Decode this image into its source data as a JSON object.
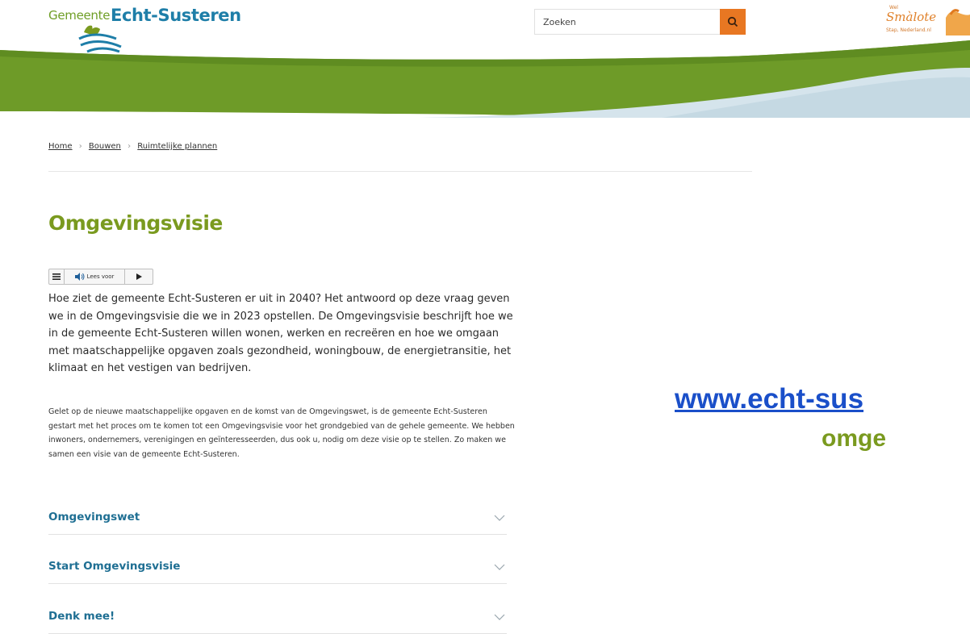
{
  "header": {
    "logo": {
      "prefix": "Gemeente",
      "name": "Echt-Susteren"
    },
    "search": {
      "placeholder": "Zoeken",
      "button_icon": "search-icon"
    },
    "partner_logo": {
      "top_text": "Wel",
      "text": "Smàlote",
      "sub_text": "Stap, Nederland.nl"
    }
  },
  "colors": {
    "brand_green": "#7a9a1f",
    "brand_blue": "#1e7ea8",
    "accent_orange": "#e87722",
    "link_blue": "#1a4fc9"
  },
  "breadcrumb": {
    "items": [
      "Home",
      "Bouwen",
      "Ruimtelijke plannen"
    ],
    "separator": "›"
  },
  "page": {
    "title": "Omgevingsvisie",
    "readspeaker": {
      "menu_icon": "menu-icon",
      "speaker_icon": "speaker-icon",
      "label": "Lees voor",
      "play_icon": "play-icon"
    },
    "lead": "Hoe ziet de gemeente Echt-Susteren er uit in 2040? Het antwoord op deze vraag geven we in de Omgevingsvisie die we in 2023 opstellen. De Omgevingsvisie beschrijft hoe we in de gemeente Echt-Susteren willen wonen, werken en recreëren en hoe we omgaan met maatschappelijke opgaven zoals gezondheid, woningbouw, de energietransitie, het klimaat en het vestigen van bedrijven.",
    "body": "Gelet op de nieuwe maatschappelijke opgaven en de komst van de Omgevingswet, is de gemeente Echt-Susteren gestart met het proces om te komen tot een Omgevingsvisie voor het grondgebied van de gehele gemeente. We hebben  inwoners, ondernemers, verenigingen en geïnteresseerden, dus ook u, nodig om deze visie op te stellen. Zo maken we samen een visie van de gemeente Echt-Susteren.",
    "accordion": [
      {
        "label": "Omgevingswet"
      },
      {
        "label": "Start Omgevingsvisie"
      },
      {
        "label": "Denk mee!"
      }
    ]
  },
  "overlay": {
    "url_text": "www.echt-sus",
    "omg_text": "omge"
  }
}
